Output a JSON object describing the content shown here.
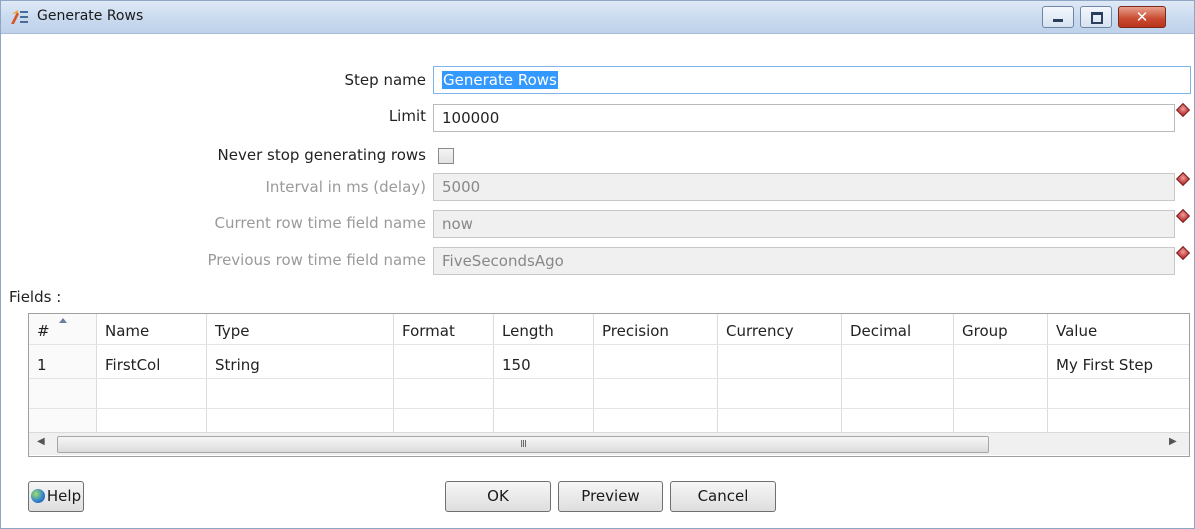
{
  "window": {
    "title": "Generate Rows"
  },
  "form": {
    "step_name_label": "Step name",
    "step_name_value": "Generate Rows",
    "limit_label": "Limit",
    "limit_value": "100000",
    "never_stop_label": "Never stop generating rows",
    "never_stop_checked": false,
    "interval_label": "Interval in ms (delay)",
    "interval_value": "5000",
    "current_row_label": "Current row time field name",
    "current_row_value": "now",
    "previous_row_label": "Previous row time field name",
    "previous_row_value": "FiveSecondsAgo"
  },
  "fields_label": "Fields :",
  "table": {
    "columns": [
      "#",
      "Name",
      "Type",
      "Format",
      "Length",
      "Precision",
      "Currency",
      "Decimal",
      "Group",
      "Value"
    ],
    "rows": [
      [
        "1",
        "FirstCol",
        "String",
        "",
        "150",
        "",
        "",
        "",
        "",
        "My First Step"
      ]
    ],
    "scroll_grip": "III"
  },
  "buttons": {
    "help": "Help",
    "ok": "OK",
    "preview": "Preview",
    "cancel": "Cancel"
  },
  "colors": {
    "selection": "#3399ff",
    "title_bar": "#c9daef",
    "close_button": "#c9492f",
    "disabled_field": "#f0f0f0"
  }
}
